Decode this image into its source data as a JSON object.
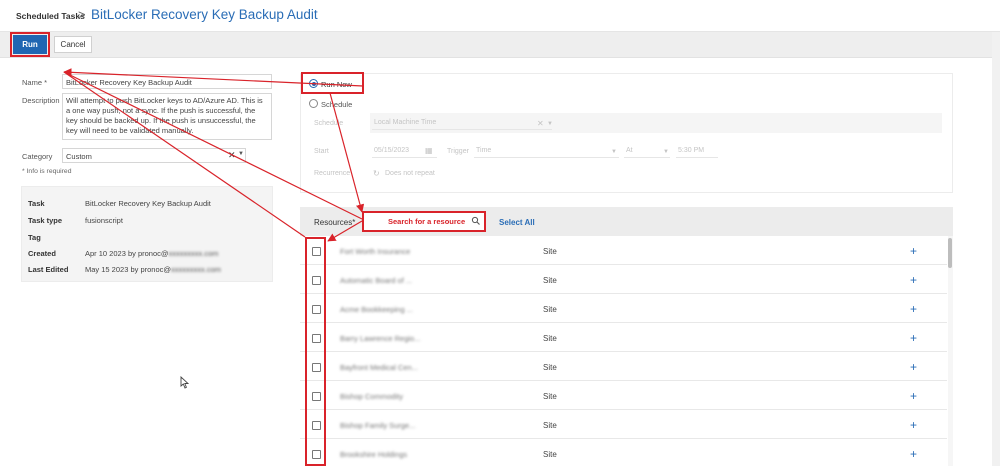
{
  "header": {
    "breadcrumb_parent": "Scheduled Tasks",
    "breadcrumb_sep": ">",
    "title": "BitLocker Recovery Key Backup Audit"
  },
  "toolbar": {
    "run_label": "Run",
    "cancel_label": "Cancel"
  },
  "form": {
    "name_label": "Name *",
    "name_value": "BitLocker Recovery Key Backup Audit",
    "description_label": "Description",
    "description_value": "Will attempt to push BitLocker keys to AD/Azure AD. This is a one way push, not a sync. If the push is successful, the key should be backed up. If the push is unsuccessful, the key will need to be validated manually.",
    "category_label": "Category",
    "category_value": "Custom",
    "info_required": "* Info is required"
  },
  "details": {
    "task_label": "Task",
    "task_value": "BitLocker Recovery Key Backup Audit",
    "task_type_label": "Task type",
    "task_type_value": "fusionscript",
    "tag_label": "Tag",
    "tag_value": "",
    "created_label": "Created",
    "created_value": "Apr 10 2023 by pronoc@",
    "created_email_blurred": "xxxxxxxxx.com",
    "last_edited_label": "Last Edited",
    "last_edited_value": "May 15 2023 by pronoc@",
    "last_edited_email_blurred": "xxxxxxxxx.com"
  },
  "schedule": {
    "run_now_label": "Run Now",
    "run_now_selected": true,
    "schedule_label": "Schedule",
    "schedule_field_label": "Schedule",
    "schedule_field_value": "Local Machine Time",
    "start_label": "Start",
    "start_date": "05/15/2023",
    "trigger_label": "Trigger",
    "trigger_value": "Time",
    "at_label": "At",
    "time_value": "5:30 PM",
    "recurrence_label": "Recurrence",
    "recurrence_value": "Does not repeat"
  },
  "resources": {
    "label": "Resources*",
    "search_placeholder": "Search for a resource",
    "select_all_label": "Select All",
    "rows": [
      {
        "name": "Fort Worth Insurance",
        "type": "Site"
      },
      {
        "name": "Automatic Board of ...",
        "type": "Site"
      },
      {
        "name": "Acme Bookkeeping ...",
        "type": "Site"
      },
      {
        "name": "Barry Lawrence Regio...",
        "type": "Site"
      },
      {
        "name": "Bayfront Medical Cen...",
        "type": "Site"
      },
      {
        "name": "Bishop Commodity",
        "type": "Site"
      },
      {
        "name": "Bishop Family Surge...",
        "type": "Site"
      },
      {
        "name": "Brookshire Holdings",
        "type": "Site"
      }
    ]
  },
  "colors": {
    "accent": "#2066b2",
    "title_blue": "#2a6db6",
    "annotation_red": "#d9232a"
  }
}
